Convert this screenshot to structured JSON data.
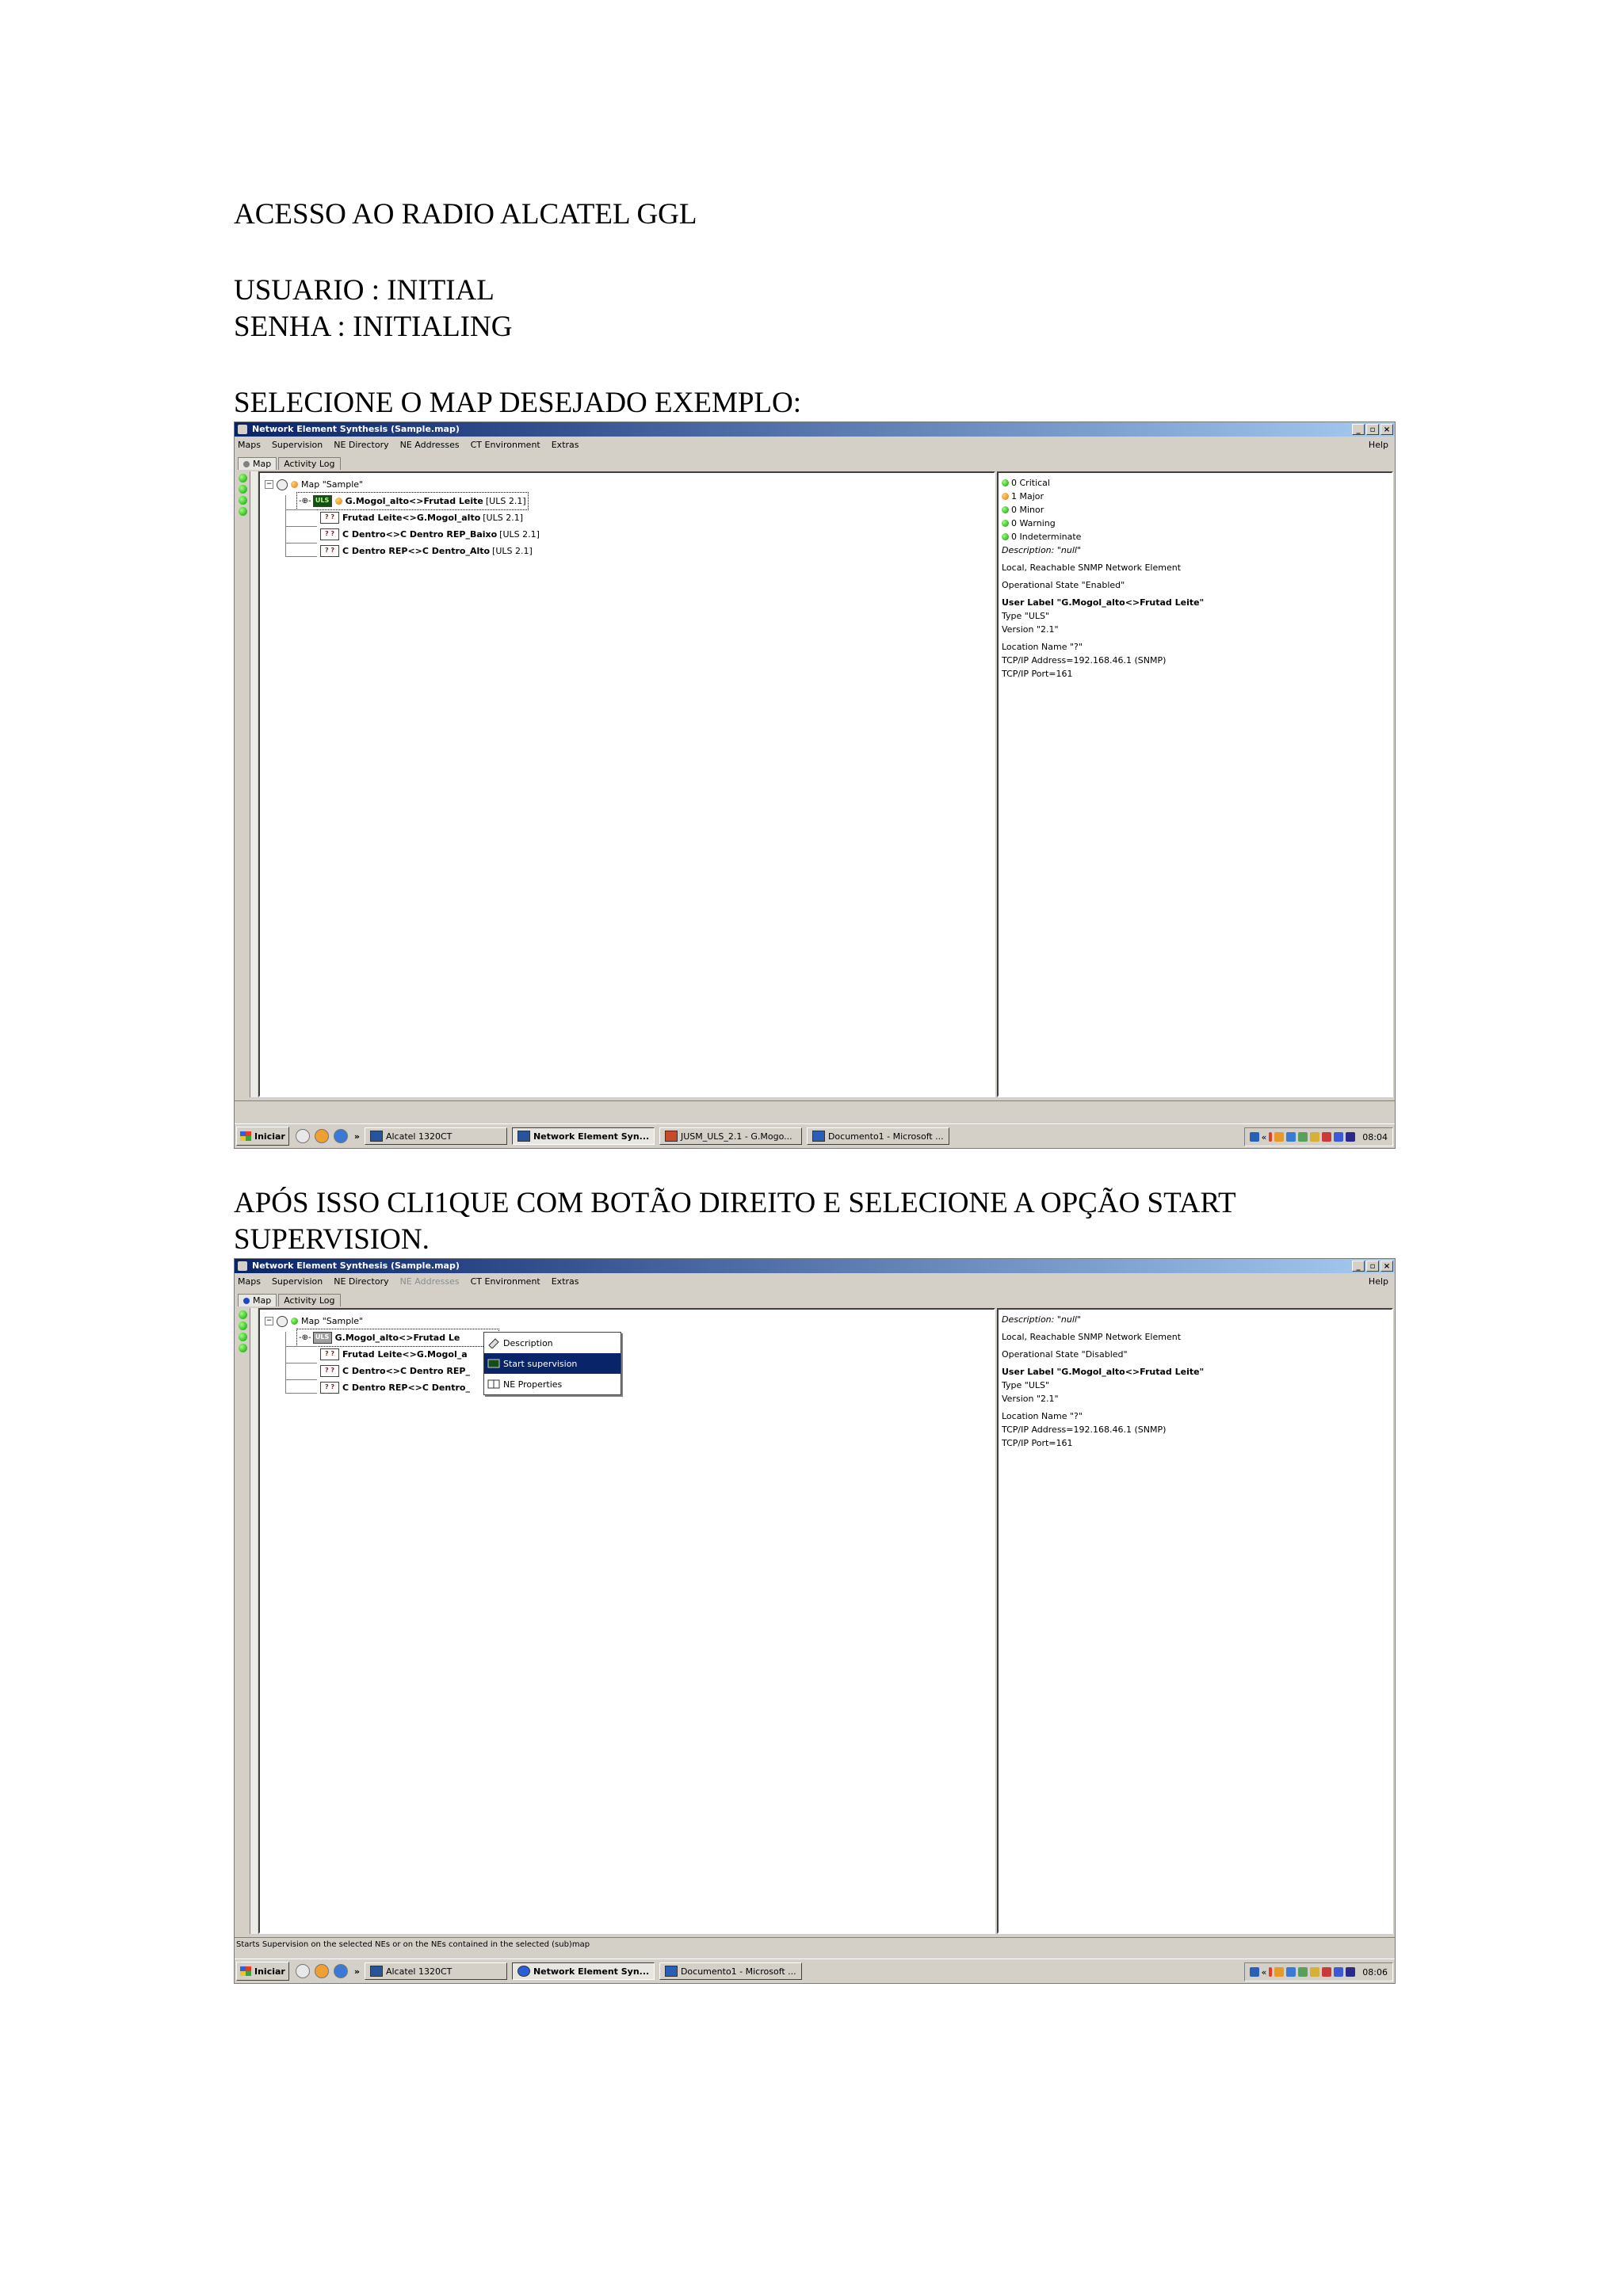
{
  "doc": {
    "heading": "ACESSO AO RADIO ALCATEL GGL",
    "user_line": "USUARIO : INITIAL",
    "pass_line": "SENHA : INITIALING",
    "step1": "SELECIONE O MAP DESEJADO EXEMPLO:",
    "step2_line1": "APÓS ISSO CLI1QUE COM BOTÃO DIREITO E SELECIONE A OPÇÃO START",
    "step2_line2": "SUPERVISION."
  },
  "app": {
    "title": "Network Element Synthesis (Sample.map)",
    "menus": [
      "Maps",
      "Supervision",
      "NE Directory",
      "NE Addresses",
      "CT Environment",
      "Extras"
    ],
    "help": "Help",
    "tabs": [
      "Map",
      "Activity Log"
    ]
  },
  "shot1": {
    "tree_root": "Map \"Sample\"",
    "tree_items": [
      {
        "badge": "ULS",
        "label": "G.Mogol_alto<>Frutad Leite",
        "tag": "[ULS 2.1]"
      },
      {
        "badge": "? ?",
        "label": "Frutad Leite<>G.Mogol_alto",
        "tag": "[ULS 2.1]"
      },
      {
        "badge": "? ?",
        "label": "C Dentro<>C Dentro REP_Baixo",
        "tag": "[ULS 2.1]"
      },
      {
        "badge": "? ?",
        "label": "C Dentro REP<>C Dentro_Alto",
        "tag": "[ULS 2.1]"
      }
    ],
    "alarms": [
      "0 Critical",
      "1 Major",
      "0 Minor",
      "0 Warning",
      "0 Indeterminate"
    ],
    "description": "Description: \"null\"",
    "info1": "Local, Reachable SNMP Network Element",
    "op_state": "Operational State \"Enabled\"",
    "user_label": "User Label \"G.Mogol_alto<>Frutad Leite\"",
    "type": "Type \"ULS\"",
    "version": "Version \"2.1\"",
    "location": "Location Name \"?\"",
    "tcpip": "TCP/IP Address=192.168.46.1 (SNMP)",
    "port": "TCP/IP Port=161",
    "taskbar": {
      "start": "Iniciar",
      "chevron": "»",
      "buttons": [
        "Alcatel 1320CT",
        "Network Element Syn...",
        "JUSM_ULS_2.1 - G.Mogo...",
        "Documento1 - Microsoft ..."
      ],
      "clock": "08:04",
      "tray_label": "«"
    }
  },
  "shot2": {
    "tree_root": "Map \"Sample\"",
    "tree_items": [
      {
        "badge": "ULS",
        "label": "G.Mogol_alto<>Frutad Le"
      },
      {
        "badge": "? ?",
        "label": "Frutad Leite<>G.Mogol_a"
      },
      {
        "badge": "? ?",
        "label": "C Dentro<>C Dentro REP_"
      },
      {
        "badge": "? ?",
        "label": "C Dentro REP<>C Dentro_"
      }
    ],
    "context_menu": [
      "Description",
      "Start supervision",
      "NE Properties"
    ],
    "description": "Description: \"null\"",
    "info1": "Local, Reachable SNMP Network Element",
    "op_state": "Operational State \"Disabled\"",
    "user_label": "User Label \"G.Mogol_alto<>Frutad Leite\"",
    "type": "Type \"ULS\"",
    "version": "Version \"2.1\"",
    "location": "Location Name \"?\"",
    "tcpip": "TCP/IP Address=192.168.46.1 (SNMP)",
    "port": "TCP/IP Port=161",
    "statusbar": "Starts Supervision on the selected NEs or on the NEs contained in the selected (sub)map",
    "taskbar": {
      "start": "Iniciar",
      "chevron": "»",
      "buttons": [
        "Alcatel 1320CT",
        "Network Element Syn...",
        "Documento1 - Microsoft ..."
      ],
      "clock": "08:06",
      "tray_label": "«"
    }
  },
  "colors": {
    "title_bar": "#0a246a",
    "window_bg": "#d4d0c8",
    "highlight": "#0a246a"
  }
}
